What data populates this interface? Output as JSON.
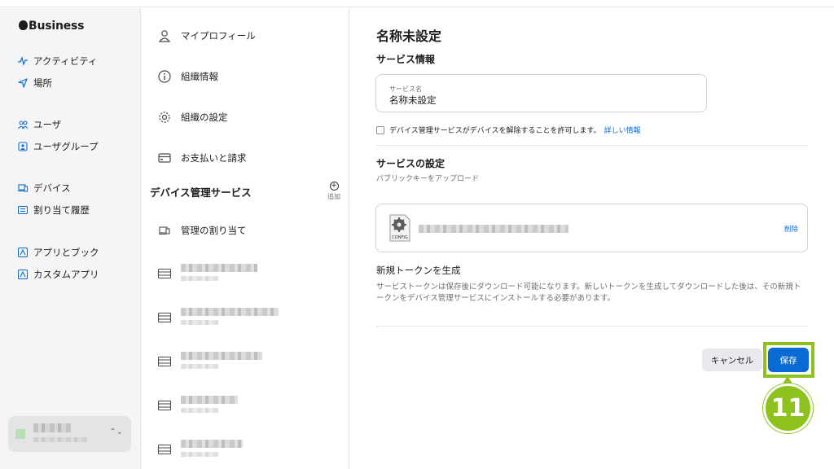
{
  "sidebar": {
    "logo_text": "Business",
    "items": [
      {
        "label": "アクティビティ",
        "icon": "activity-icon"
      },
      {
        "label": "場所",
        "icon": "location-arrow-icon"
      },
      {
        "label": "ユーザ",
        "icon": "users-icon"
      },
      {
        "label": "ユーザグループ",
        "icon": "user-group-icon"
      },
      {
        "label": "デバイス",
        "icon": "laptop-icon"
      },
      {
        "label": "割り当て履歴",
        "icon": "list-icon"
      },
      {
        "label": "アプリとブック",
        "icon": "app-icon"
      },
      {
        "label": "カスタムアプリ",
        "icon": "custom-app-icon"
      }
    ]
  },
  "middle": {
    "items": [
      {
        "label": "マイプロフィール",
        "icon": "person-icon"
      },
      {
        "label": "組織情報",
        "icon": "info-icon"
      },
      {
        "label": "組織の設定",
        "icon": "gear-icon"
      },
      {
        "label": "お支払いと請求",
        "icon": "credit-card-icon"
      }
    ],
    "section_title": "デバイス管理サービス",
    "add_label": "追加",
    "assign_label": "管理の割り当て"
  },
  "detail": {
    "title": "名称未設定",
    "service_info_heading": "サービス情報",
    "service_name_label": "サービス名",
    "service_name_value": "名称未設定",
    "release_checkbox_text": "デバイス管理サービスがデバイスを解除することを許可します。",
    "more_info_link": "詳しい情報",
    "service_settings_heading": "サービスの設定",
    "upload_public_key_text": "パブリックキーをアップロード",
    "config_icon_label": "CONFIG",
    "delete_label": "削除",
    "token_heading": "新規トークンを生成",
    "token_description": "サービストークンは保存後にダウンロード可能になります。新しいトークンを生成してダウンロードした後は、その新規トークンをデバイス管理サービスにインストールする必要があります。",
    "cancel_label": "キャンセル",
    "save_label": "保存"
  },
  "callout_number": "11",
  "colors": {
    "accent": "#0a6bd4",
    "highlight": "#8dc21f"
  }
}
